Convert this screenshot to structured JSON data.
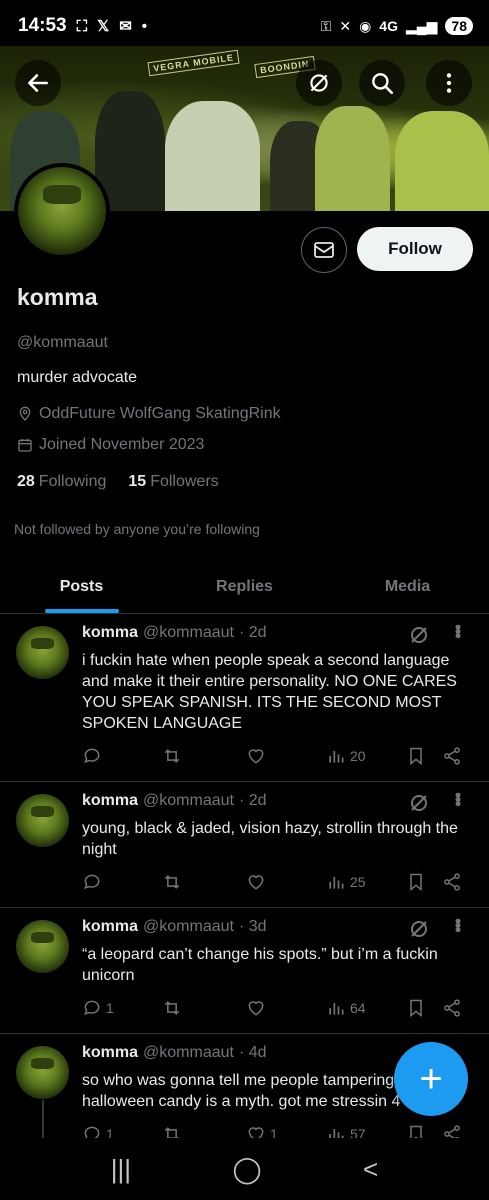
{
  "status_bar": {
    "time": "14:53",
    "battery": "78",
    "network": "4G"
  },
  "profile": {
    "name": "komma",
    "handle": "@kommaaut",
    "bio": "murder advocate",
    "location": "OddFuture WolfGang SkatingRink",
    "joined": "Joined November 2023",
    "following_count": "28",
    "following_label": "Following",
    "followers_count": "15",
    "followers_label": "Followers",
    "not_followed": "Not followed by anyone you’re following",
    "follow_label": "Follow"
  },
  "banner_signs": {
    "sign1": "VEGRA MOBILE",
    "sign2": "BOONDIN"
  },
  "tabs": [
    {
      "label": "Posts",
      "active": true
    },
    {
      "label": "Replies",
      "active": false
    },
    {
      "label": "Media",
      "active": false
    }
  ],
  "posts": [
    {
      "name": "komma",
      "handle": "@kommaaut",
      "time": "· 2d",
      "text": "i fuckin hate when people speak a second language and make it their entire personality. NO ONE CARES YOU SPEAK SPANISH. ITS THE SECOND MOST SPOKEN LANGUAGE",
      "replies": "",
      "reposts": "",
      "likes": "",
      "views": "20"
    },
    {
      "name": "komma",
      "handle": "@kommaaut",
      "time": "· 2d",
      "text": "young, black & jaded, vision hazy, strollin through the night",
      "replies": "",
      "reposts": "",
      "likes": "",
      "views": "25"
    },
    {
      "name": "komma",
      "handle": "@kommaaut",
      "time": "· 3d",
      "text": "“a leopard can’t change his spots.” but i’m a fuckin unicorn",
      "replies": "1",
      "reposts": "",
      "likes": "",
      "views": "64"
    },
    {
      "name": "komma",
      "handle": "@kommaaut",
      "time": "· 4d",
      "text": "so who was gonna tell me people tampering halloween candy is a myth. got me stressin 4",
      "replies": "1",
      "reposts": "",
      "likes": "1",
      "views": "57"
    }
  ],
  "colors": {
    "accent": "#1d9bf0",
    "muted": "#71767b",
    "border": "#2f3336",
    "text": "#e7e9ea"
  },
  "icons": [
    "back-arrow-icon",
    "grok-icon",
    "search-icon",
    "more-vertical-icon",
    "mail-icon",
    "location-icon",
    "calendar-icon",
    "reply-icon",
    "repost-icon",
    "like-icon",
    "views-icon",
    "bookmark-icon",
    "share-icon",
    "plus-icon"
  ]
}
